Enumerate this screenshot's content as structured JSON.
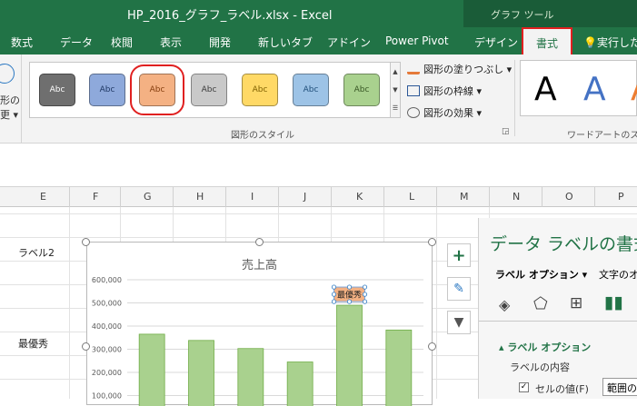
{
  "window": {
    "title": "HP_2016_グラフ_ラベル.xlsx  -  Excel",
    "tool_context": "グラフ ツール"
  },
  "tabs": [
    {
      "label": "数式"
    },
    {
      "label": "データ"
    },
    {
      "label": "校閲"
    },
    {
      "label": "表示"
    },
    {
      "label": "開発"
    },
    {
      "label": "新しいタブ"
    },
    {
      "label": "アドイン"
    },
    {
      "label": "Power Pivot"
    },
    {
      "label": "デザイン"
    },
    {
      "label": "書式"
    }
  ],
  "tell_me": "実行した",
  "ribbon": {
    "left_stub": {
      "line1": "形の",
      "line2": "更 ▾"
    },
    "shape_styles": [
      {
        "label": "Abc",
        "fill": "#6f6f6f",
        "text": "#ffffff"
      },
      {
        "label": "Abc",
        "fill": "#8ea9db",
        "text": "#1f3864"
      },
      {
        "label": "Abc",
        "fill": "#f4b183",
        "text": "#843c0c"
      },
      {
        "label": "Abc",
        "fill": "#c9c9c9",
        "text": "#3a3a3a"
      },
      {
        "label": "Abc",
        "fill": "#ffd966",
        "text": "#7f6000"
      },
      {
        "label": "Abc",
        "fill": "#9dc3e6",
        "text": "#1f4e79"
      },
      {
        "label": "Abc",
        "fill": "#a9d18e",
        "text": "#375623"
      }
    ],
    "fill_cmd": "図形の塗りつぶし ▾",
    "outline_cmd": "図形の枠線 ▾",
    "effect_cmd": "図形の効果 ▾",
    "group_label": "図形のスタイル",
    "wordart_label": "ワードアートのスタ"
  },
  "columns": [
    "E",
    "F",
    "G",
    "H",
    "I",
    "J",
    "K",
    "L",
    "M",
    "N",
    "O",
    "P"
  ],
  "cells": {
    "label2": "ラベル2",
    "best": "最優秀"
  },
  "chart": {
    "title": "売上高",
    "callout": "最優秀",
    "bar_color": "#a9d18e",
    "bar_edge": "#70ad47"
  },
  "chart_data": {
    "type": "bar",
    "title": "売上高",
    "y_ticks": [
      "600,000",
      "500,000",
      "400,000",
      "300,000",
      "200,000",
      "100,000"
    ],
    "values": [
      365000,
      338000,
      303000,
      245000,
      490000,
      383000
    ],
    "ylim": [
      0,
      600000
    ],
    "data_label": {
      "index": 4,
      "text": "最優秀"
    }
  },
  "pane": {
    "title": "データ ラベルの書式",
    "tab1": "ラベル オプション ▾",
    "tab2": "文字のオ",
    "section": "ラベル オプション",
    "content": "ラベルの内容",
    "cell_value": "セルの値(F)",
    "range_button": "範囲の選"
  }
}
